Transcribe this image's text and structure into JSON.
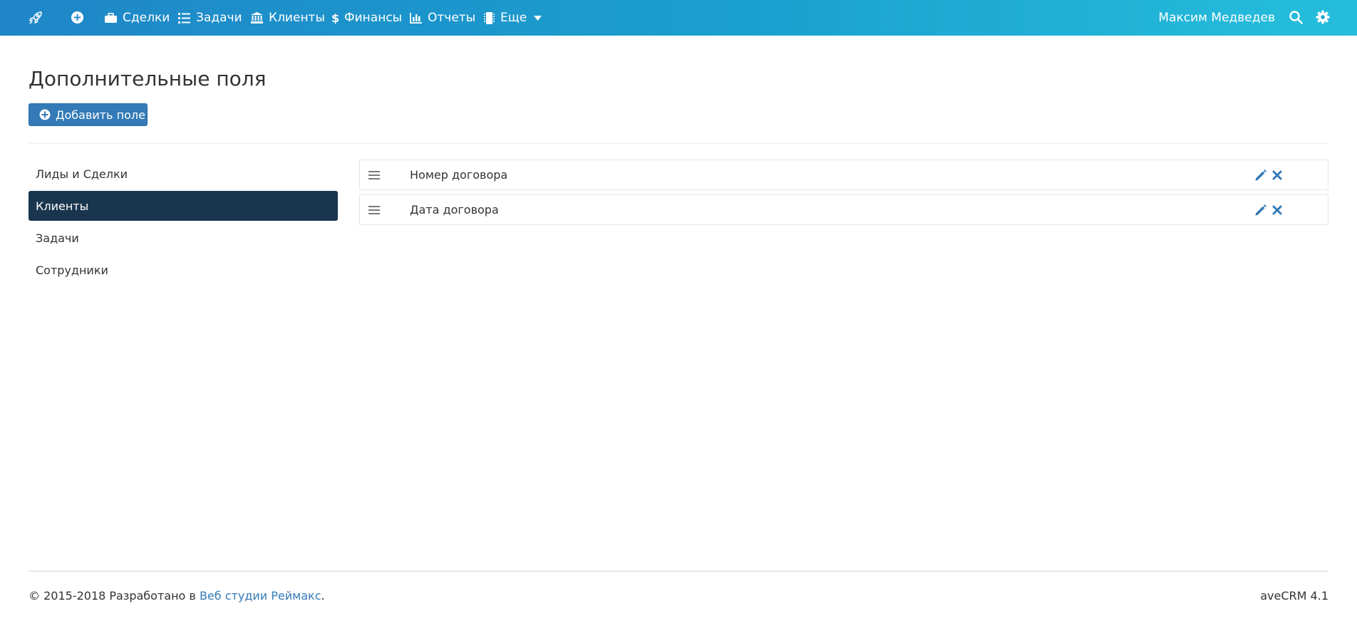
{
  "colors": {
    "topbar_start": "#1f86c7",
    "topbar_end": "#26bedc",
    "primary": "#337ab7",
    "sidebar_active": "#1a364f",
    "link": "#337ab7"
  },
  "topbar": {
    "logo_icon": "rocket-icon",
    "add_icon": "plus-circle-icon",
    "nav": [
      {
        "label": "Сделки",
        "icon": "briefcase-icon"
      },
      {
        "label": "Задачи",
        "icon": "list-icon"
      },
      {
        "label": "Клиенты",
        "icon": "bank-icon"
      },
      {
        "label": "Финансы",
        "icon": "dollar-icon"
      },
      {
        "label": "Отчеты",
        "icon": "bar-chart-icon"
      },
      {
        "label": "Еще",
        "icon": "microchip-icon"
      }
    ],
    "user_name": "Максим Медведев",
    "search_icon": "search-icon",
    "settings_icon": "gear-icon"
  },
  "page": {
    "title": "Дополнительные поля",
    "add_button_label": "Добавить поле"
  },
  "sidebar": {
    "items": [
      {
        "label": "Лиды и Сделки",
        "active": false
      },
      {
        "label": "Клиенты",
        "active": true
      },
      {
        "label": "Задачи",
        "active": false
      },
      {
        "label": "Сотрудники",
        "active": false
      }
    ]
  },
  "fields": [
    {
      "label": "Номер договора"
    },
    {
      "label": "Дата договора"
    }
  ],
  "footer": {
    "copyright": "© 2015-2018 Разработано в",
    "link_text": "Веб студии Реймакс",
    "period": ".",
    "version": "aveCRM 4.1"
  }
}
